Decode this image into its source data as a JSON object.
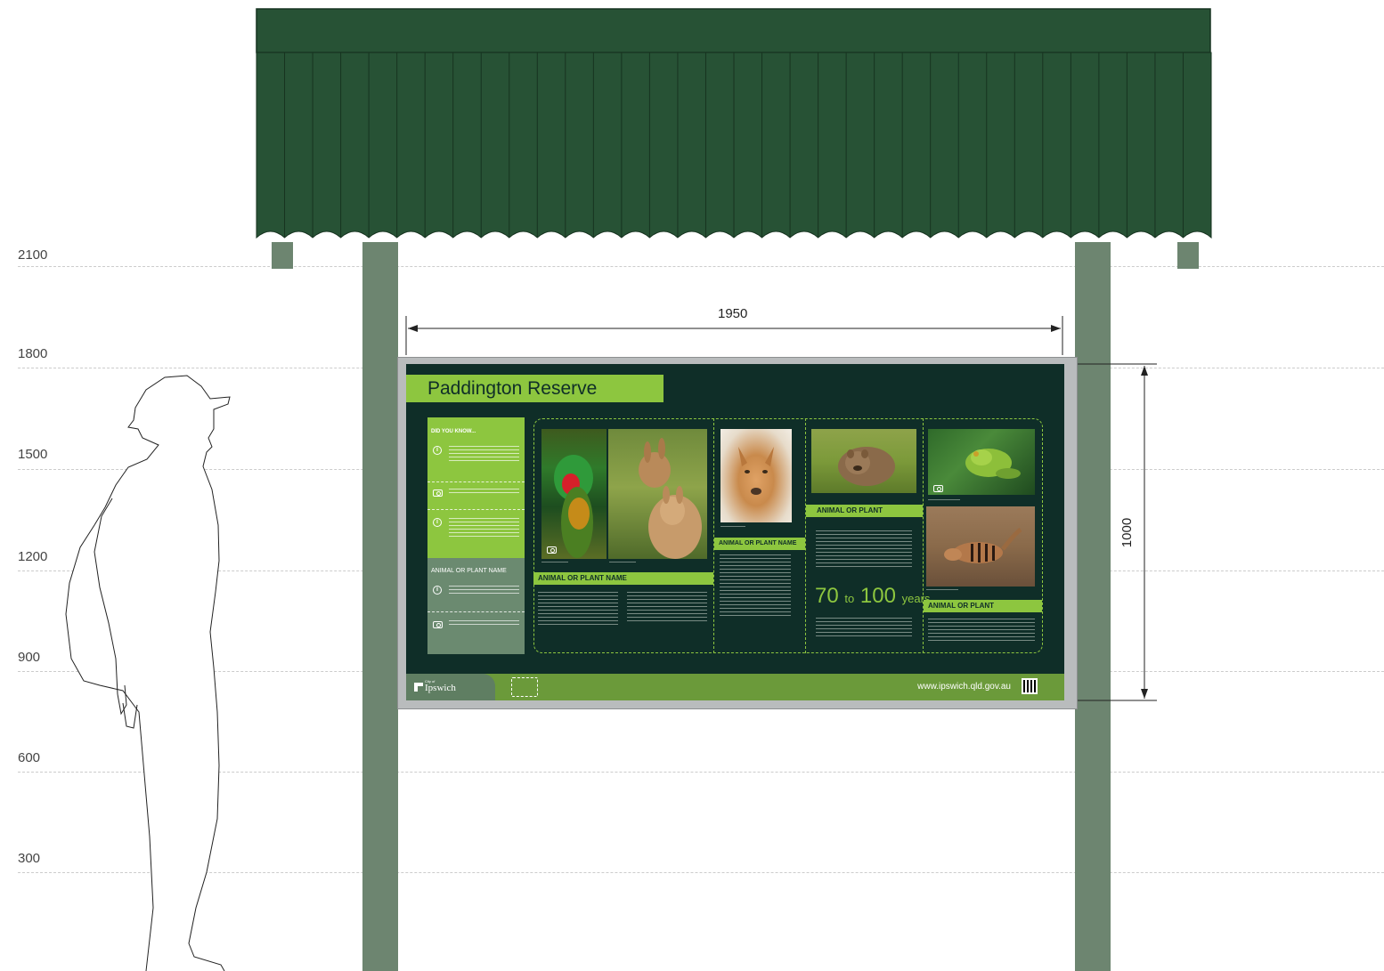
{
  "height_scale": {
    "labels": [
      "2100",
      "1800",
      "1500",
      "1200",
      "900",
      "600",
      "300"
    ]
  },
  "dimensions": {
    "width": "1950",
    "height": "1000"
  },
  "sign": {
    "title": "Paddington Reserve",
    "sidebar": {
      "did_you_know": "DID YOU KNOW...",
      "animal_or_plant_name": "ANIMAL OR PLANT NAME"
    },
    "sections": [
      {
        "label": "ANIMAL OR PLANT NAME"
      },
      {
        "label": "ANIMAL OR PLANT NAME"
      },
      {
        "label": "ANIMAL OR PLANT"
      },
      {
        "label": "ANIMAL OR PLANT"
      }
    ],
    "stat": {
      "from": "70",
      "to_word": "to",
      "to": "100",
      "unit": "years"
    },
    "footer": {
      "logo_small": "City of",
      "logo_text": "Ipswich",
      "url": "www.ipswich.qld.gov.au"
    }
  },
  "icons": [
    "info-icon",
    "camera-icon",
    "qr-code-icon",
    "person-silhouette"
  ],
  "colors": {
    "roof": "#275235",
    "post": "#6d8570",
    "panel_bg": "#0f2e28",
    "accent_green": "#8dc63f",
    "muted_green": "#6b8a70",
    "footer_green": "#6b9a3a"
  }
}
